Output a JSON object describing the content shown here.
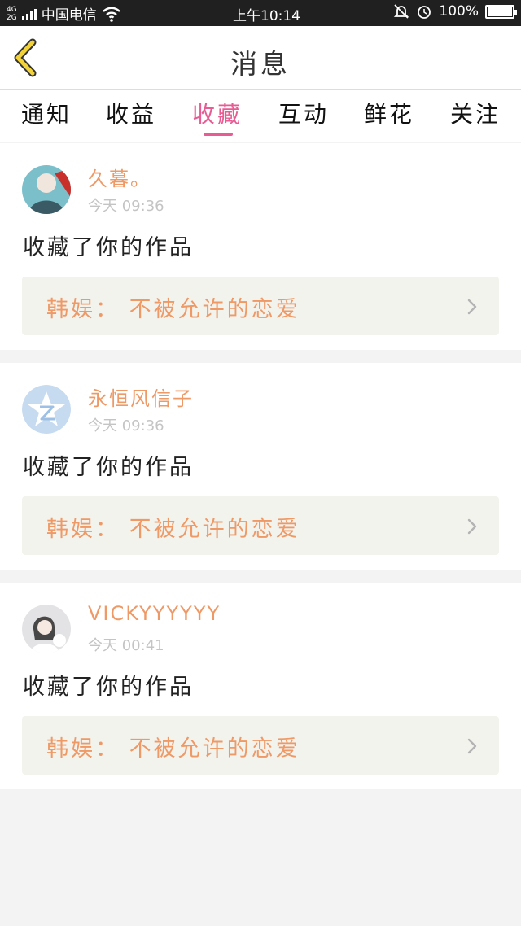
{
  "status_bar": {
    "network_top": "4G",
    "network_bottom": "2G",
    "carrier": "中国电信",
    "time": "上午10:14",
    "battery": "100%",
    "battery_level": 1.0,
    "icons": [
      "signal-icon",
      "wifi-icon",
      "mute-icon",
      "alarm-icon",
      "battery-icon"
    ]
  },
  "header": {
    "title": "消息",
    "back_icon": "chevron-left-icon"
  },
  "tabs": [
    {
      "label": "通知"
    },
    {
      "label": "收益"
    },
    {
      "label": "收藏"
    },
    {
      "label": "互动"
    },
    {
      "label": "鲜花"
    },
    {
      "label": "关注"
    }
  ],
  "active_tab": "收藏",
  "notifications": [
    {
      "username": "久暮。",
      "time": "今天 09:36",
      "action": "收藏了你的作品",
      "work": "韩娱：  不被允许的恋爱"
    },
    {
      "username": "永恒风信子",
      "time": "今天 09:36",
      "action": "收藏了你的作品",
      "work": "韩娱：  不被允许的恋爱"
    },
    {
      "username": "VICKYYYYYY",
      "time": "今天 00:41",
      "action": "收藏了你的作品",
      "work": "韩娱：  不被允许的恋爱"
    }
  ],
  "colors": {
    "accent": "#e85c94",
    "name": "#ee9966",
    "back_arrow": "#f2d23a",
    "status_bar": "#202020",
    "link_bg": "#f3f3ee"
  }
}
